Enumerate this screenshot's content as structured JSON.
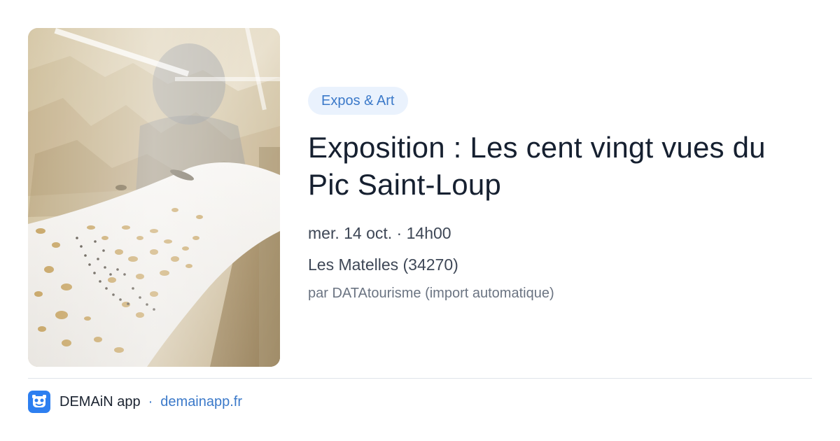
{
  "photo": {
    "icon": "museum-display-photo"
  },
  "event": {
    "category": "Expos & Art",
    "title": "Exposition : Les cent vingt vues du Pic Saint-Loup",
    "datetime": "mer. 14 oct. · 14h00",
    "location": "Les Matelles (34270)",
    "source": "par DATAtourisme (import automatique)"
  },
  "footer": {
    "logo_icon": "demain-app-logo-icon",
    "app_name": "DEMAiN app",
    "separator": "·",
    "site": "demainapp.fr"
  },
  "colors": {
    "accent": "#3b79c9",
    "tag_bg": "#eaf2fd",
    "logo_bg": "#2d7ff0"
  }
}
